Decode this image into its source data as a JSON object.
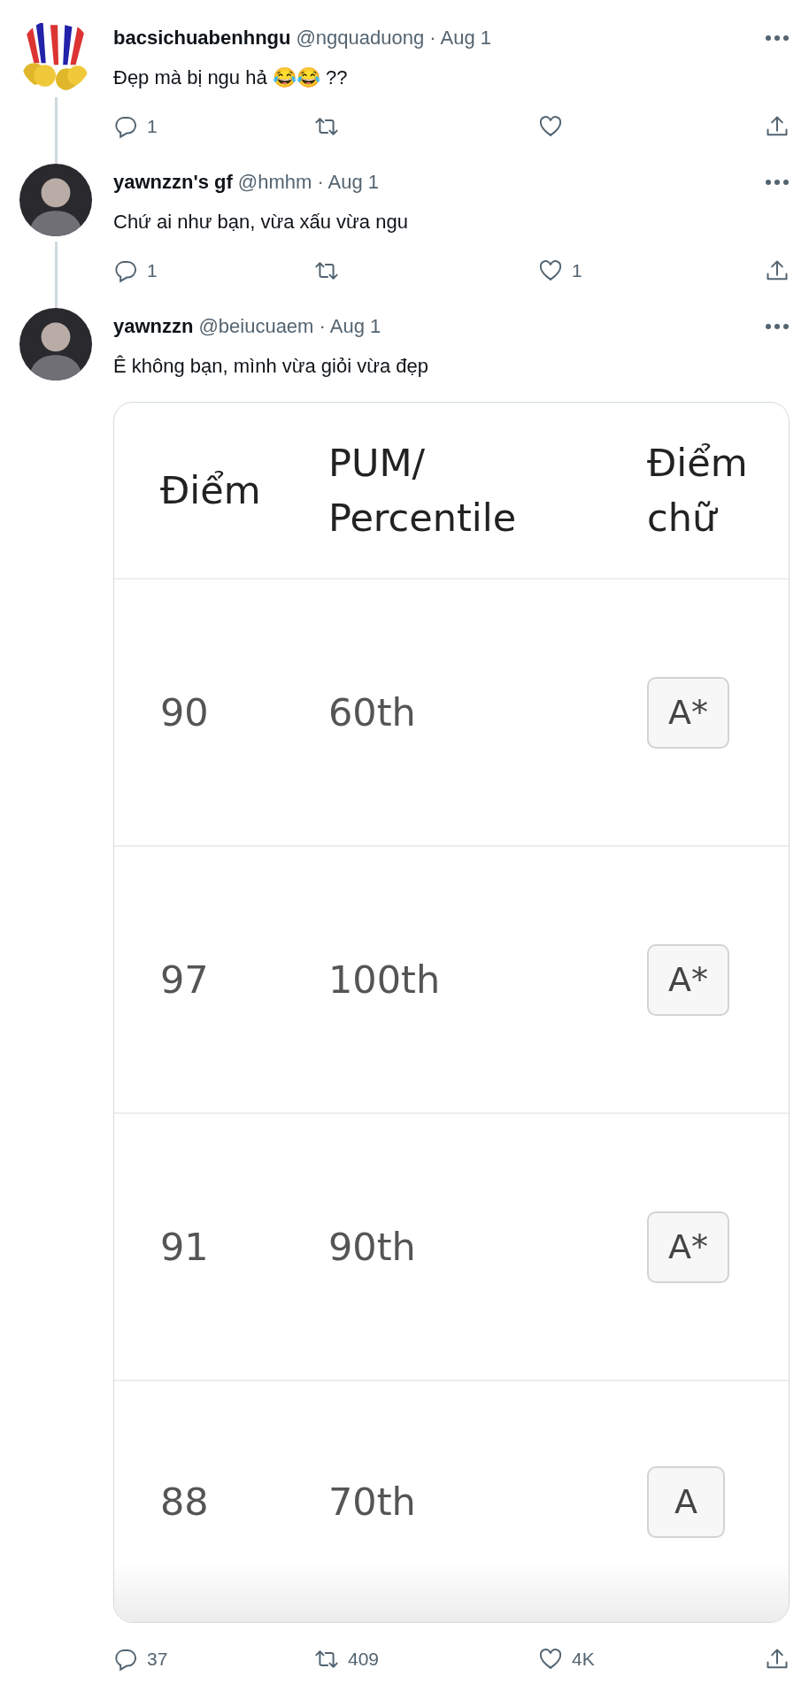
{
  "tweets": [
    {
      "name": "bacsichuabenhngu",
      "handle": "@ngquaduong",
      "separator": "·",
      "date": "Aug 1",
      "text": "Đẹp mà bị ngu hả 😂😂 ??",
      "thread_line": true,
      "reply_count": "1"
    },
    {
      "name": "yawnzzn's gf",
      "handle": "@hmhm",
      "separator": "·",
      "date": "Aug 1",
      "avatar": {
        "kind": "person"
      },
      "text": "Chứ ai như bạn, vừa xấu vừa ngu",
      "thread_line": true,
      "reply_count": "1",
      "like_count": "1"
    },
    {
      "name": "yawnzzn",
      "handle": "@beiucuaem",
      "separator": "·",
      "date": "Aug 1",
      "avatar": {
        "kind": "person"
      },
      "text": "Ê không bạn, mình vừa giỏi vừa đẹp",
      "thread_line": false,
      "reply_count": "37",
      "retweet_count": "409",
      "like_count": "4K",
      "media": {
        "columns": [
          "Điểm",
          "PUM/ Percentile",
          "Điểm chữ"
        ],
        "rows": [
          {
            "score": "90",
            "percentile": "60th",
            "grade": "A*"
          },
          {
            "score": "97",
            "percentile": "100th",
            "grade": "A*"
          },
          {
            "score": "91",
            "percentile": "90th",
            "grade": "A*"
          },
          {
            "score": "88",
            "percentile": "70th",
            "grade": "A"
          }
        ]
      }
    }
  ]
}
